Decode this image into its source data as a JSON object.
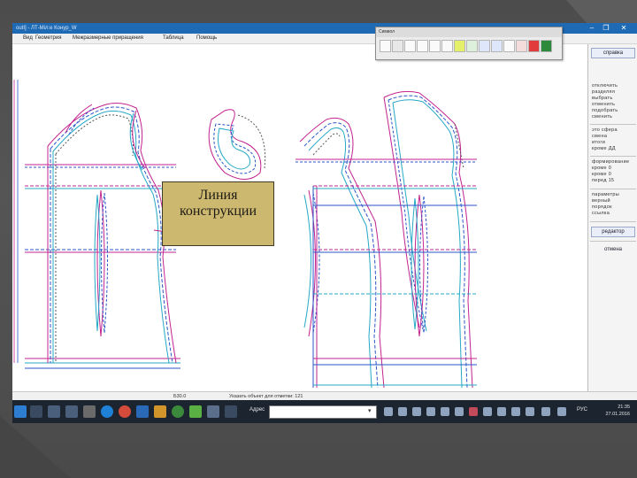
{
  "window": {
    "title": "outI] - ЛТ-Мiл:е Конур_W",
    "minimize_glyph": "–",
    "maximize_glyph": "❐",
    "close_glyph": "✕"
  },
  "menu": {
    "items": [
      "Вид",
      "Геометрия",
      "Межразмерные приращения",
      "Таблица",
      "Помощь"
    ]
  },
  "palette": {
    "title": "Символ"
  },
  "right_panel": {
    "top_button": "справка",
    "section1": "отключить\nразделяя\nвыбрать\nотменить\nподобрать\nсменить",
    "section2": "это сфера\nсмена\nитоги\nкроме ДД",
    "section3": "формирование\nкроме 0\nкроме 0\nперед 15",
    "section4": "параметры\nверный\nпорядок\nссылка",
    "button2": "редактор",
    "button3": "отмена"
  },
  "status": {
    "left": "Б30.0",
    "right": "Указать объект для отметки: 121"
  },
  "taskbar": {
    "address_label": "Адрес",
    "language": "РУС",
    "time": "21:35",
    "date": "27.01.2016"
  },
  "callout": {
    "text": "Линия конструкции"
  },
  "colors": {
    "window_title_bg": "#1e6ab5",
    "taskbar_bg": "#1c2430",
    "callout_bg": "#cdb86f",
    "pattern_magenta": "#c2238f",
    "pattern_blue": "#2a55c8",
    "pattern_cyan": "#25a8c6",
    "pattern_dark": "#555555"
  }
}
